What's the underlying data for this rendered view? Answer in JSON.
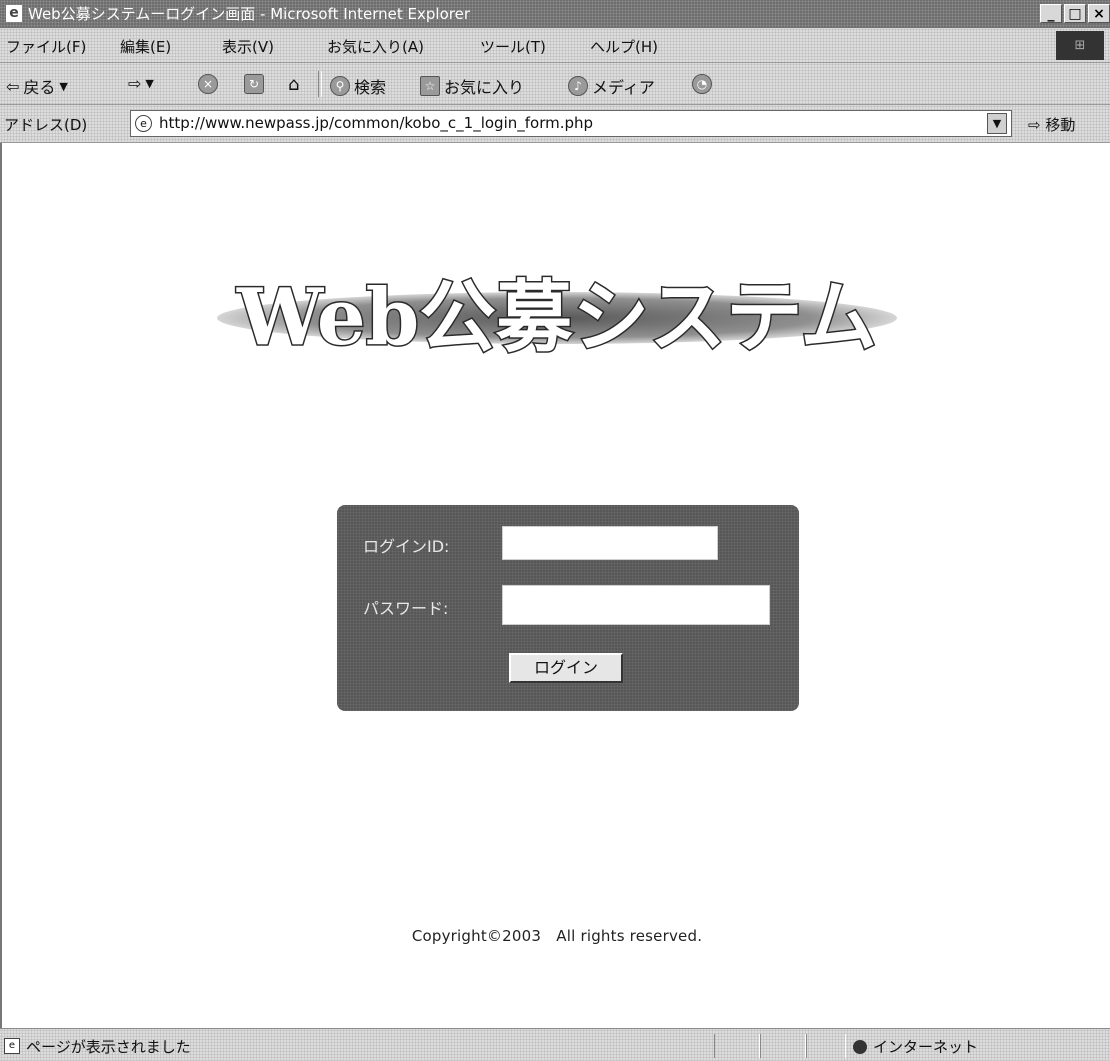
{
  "window": {
    "title": "Web公募システムーログイン画面 - Microsoft Internet Explorer",
    "app_icon": "ie-icon",
    "buttons": {
      "minimize": "_",
      "maximize": "□",
      "close": "×"
    }
  },
  "menu": {
    "items": [
      "ファイル(F)",
      "編集(E)",
      "表示(V)",
      "お気に入り(A)",
      "ツール(T)",
      "ヘルプ(H)"
    ]
  },
  "toolbar": {
    "back": "戻る",
    "search": "検索",
    "favorites": "お気に入り",
    "media": "メディア"
  },
  "address": {
    "label": "アドレス(D)",
    "url": "http://www.newpass.jp/common/kobo_c_1_login_form.php",
    "go": "移動"
  },
  "page": {
    "logo_text": "Web公募システム",
    "login": {
      "id_label": "ログインID:",
      "id_value": "",
      "password_label": "パスワード:",
      "password_value": "",
      "button_label": "ログイン"
    },
    "copyright": "Copyright©2003　All rights reserved."
  },
  "status": {
    "text": "ページが表示されました",
    "zone": "インターネット"
  },
  "colors": {
    "panel": "#555555",
    "titlebar": "#6e6e6e"
  }
}
